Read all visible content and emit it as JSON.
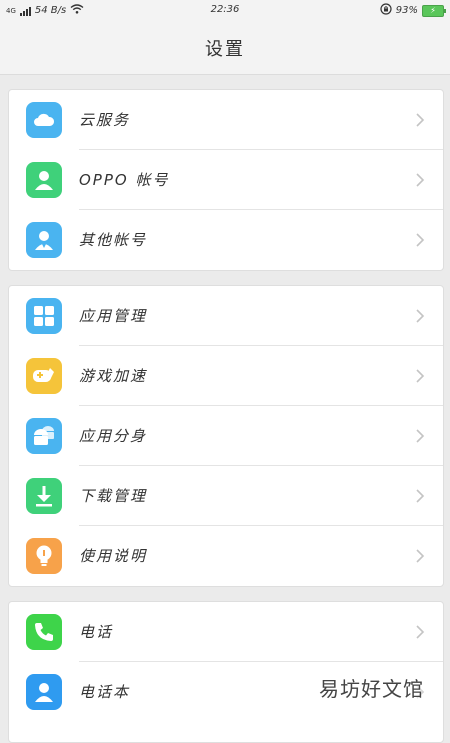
{
  "status_bar": {
    "network": "4G",
    "speed": "54 B/s",
    "time": "22:36",
    "battery": "93%"
  },
  "header": {
    "title": "设置"
  },
  "groups": [
    {
      "items": [
        {
          "label": "云服务",
          "icon": "cloud-icon",
          "color": "#4ab4f0"
        },
        {
          "label": "OPPO 帐号",
          "icon": "user-icon",
          "color": "#3fd17a"
        },
        {
          "label": "其他帐号",
          "icon": "user-badge-icon",
          "color": "#4ab4f0"
        }
      ]
    },
    {
      "items": [
        {
          "label": "应用管理",
          "icon": "app-grid-icon",
          "color": "#4ab4f0"
        },
        {
          "label": "游戏加速",
          "icon": "gamepad-icon",
          "color": "#f5c43a"
        },
        {
          "label": "应用分身",
          "icon": "android-clone-icon",
          "color": "#4ab4f0"
        },
        {
          "label": "下载管理",
          "icon": "download-icon",
          "color": "#3fd17a"
        },
        {
          "label": "使用说明",
          "icon": "lightbulb-icon",
          "color": "#f7a24a"
        }
      ]
    },
    {
      "items": [
        {
          "label": "电话",
          "icon": "phone-icon",
          "color": "#3ed44a"
        },
        {
          "label": "电话本",
          "icon": "contacts-icon",
          "color": "#2f9bf0"
        }
      ]
    }
  ],
  "watermark": "易坊好文馆"
}
